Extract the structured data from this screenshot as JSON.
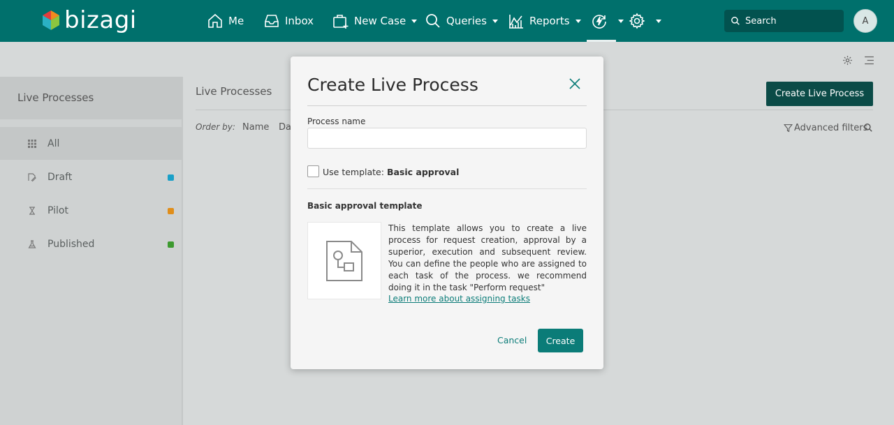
{
  "app": {
    "brand": "bizagi"
  },
  "nav": {
    "me": "Me",
    "inbox": "Inbox",
    "new_case": "New Case",
    "queries": "Queries",
    "reports": "Reports",
    "search_placeholder": "Search",
    "avatar_initial": "A"
  },
  "sidebar": {
    "title": "Live Processes",
    "items": [
      {
        "label": "All",
        "icon": "grid-icon"
      },
      {
        "label": "Draft",
        "icon": "draft-icon",
        "color": "#1aa0c8"
      },
      {
        "label": "Pilot",
        "icon": "hourglass-icon",
        "color": "#e08e1a"
      },
      {
        "label": "Published",
        "icon": "flask-icon",
        "color": "#3d9a2f"
      }
    ]
  },
  "main": {
    "title": "Live Processes",
    "order_by": "Order by:",
    "order_name": "Name",
    "order_date": "Da",
    "create_button": "Create Live Process",
    "advanced_filters": "Advanced filters"
  },
  "modal": {
    "title": "Create Live Process",
    "process_name_label": "Process name",
    "process_name_value": "",
    "use_template_prefix": "Use template:",
    "use_template_name": "Basic approval",
    "template_heading": "Basic approval template",
    "template_description": "This template allows you to create a live process for request creation, approval by a superior, execution and subsequent review. You can define the people who are assigned to each task of the process. we recommend doing it in the task \"Perform request\"",
    "learn_more": "Learn more about assigning tasks",
    "cancel": "Cancel",
    "create": "Create"
  },
  "colors": {
    "topbar": "#00706c",
    "accent": "#0b7c78",
    "dark_button": "#0b4b47"
  }
}
